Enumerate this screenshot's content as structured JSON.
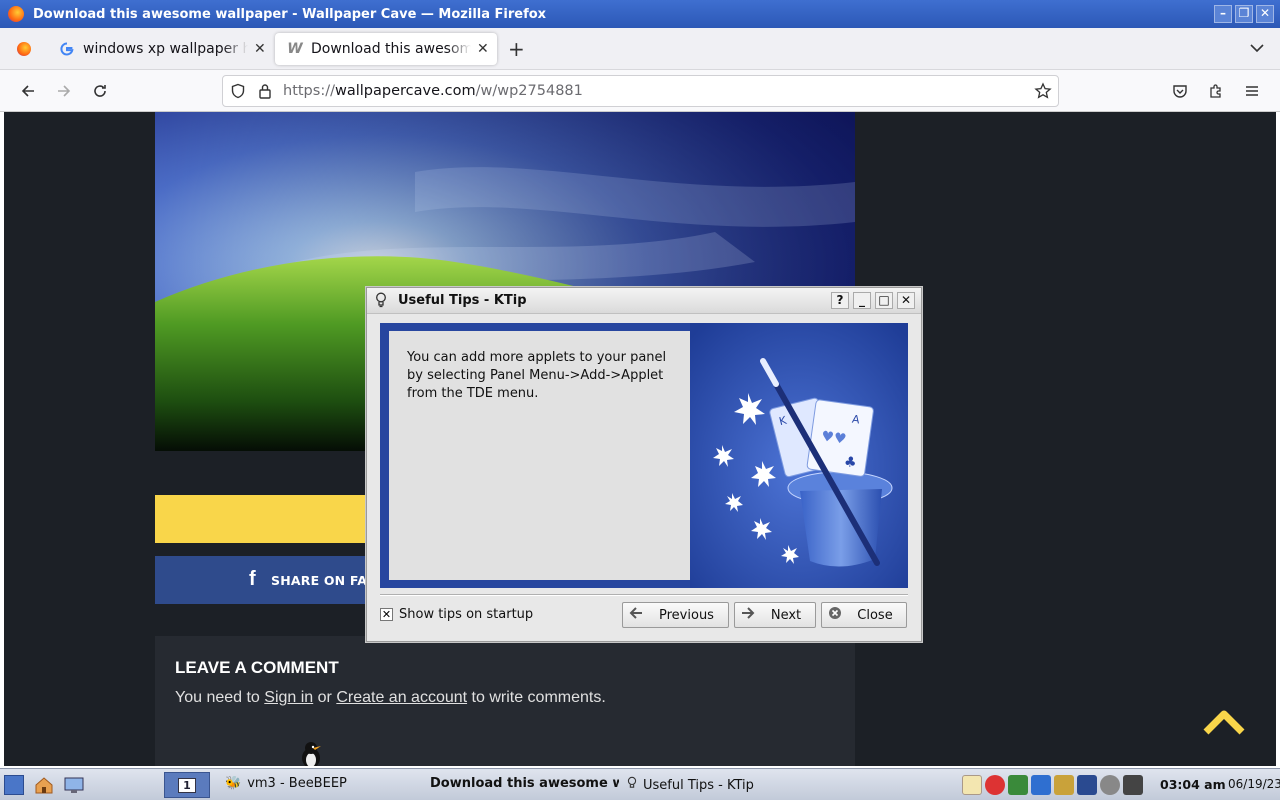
{
  "window": {
    "title": "Download this awesome wallpaper - Wallpaper Cave — Mozilla Firefox",
    "controls": [
      "minimize",
      "restore",
      "close"
    ]
  },
  "tabs": [
    {
      "label": "windows xp wallpaper high resolution - Google Search",
      "favicon": "google-g-icon",
      "active": false
    },
    {
      "label": "Download this awesome wallpaper - Wallpaper Cave",
      "favicon": "wallpapercave-icon",
      "active": true
    }
  ],
  "navbar": {
    "url_prefix": "https://",
    "url_domain": "wallpapercave.com",
    "url_path": "/w/wp2754881"
  },
  "page": {
    "share_button": "SHARE ON FACEBOOK",
    "comment_heading": "LEAVE A COMMENT",
    "comment_text_before": "You need to ",
    "sign_in_link": "Sign in",
    "comment_text_mid": " or ",
    "create_account_link": "Create an account",
    "comment_text_after": " to write comments."
  },
  "dialog": {
    "title": "Useful Tips - KTip",
    "tip_text": "You can add more applets to your panel by selecting Panel Menu->Add->Applet from the TDE menu.",
    "show_tips_label": "Show tips on startup",
    "show_tips_checked": true,
    "buttons": {
      "previous": "Previous",
      "next": "Next",
      "close": "Close"
    }
  },
  "taskbar": {
    "desktop_number": "1",
    "tasks": [
      {
        "label": "vm3 - BeeBEEP",
        "icon": "beebeep-icon"
      },
      {
        "label": "Download this awesome wallpaper",
        "icon": "firefox-icon",
        "active": true
      },
      {
        "label": "Useful Tips - KTip",
        "icon": "bulb-icon"
      }
    ],
    "clock": "03:04 am",
    "date": "06/19/23"
  },
  "colors": {
    "titlebar": "#2c58b6",
    "page_bg": "#1c2026",
    "yellow_bar": "#f9d64a",
    "facebook_blue": "#2f4b8c",
    "tip_panel": "#27469f"
  }
}
